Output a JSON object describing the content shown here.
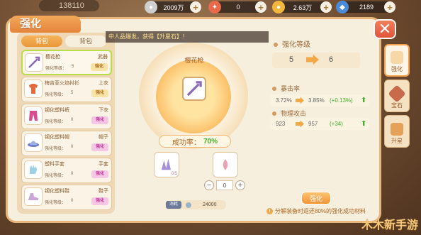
{
  "topbar": {
    "power": "138110",
    "currency": [
      {
        "value": "2009万",
        "color": "#cfcfcf",
        "icon": "silver-coin-icon"
      },
      {
        "value": "0",
        "color": "#e86a4a",
        "icon": "ticket-icon"
      },
      {
        "value": "2.63万",
        "color": "#f2b73b",
        "icon": "gold-coin-icon"
      },
      {
        "value": "2189",
        "color": "#4a8ad8",
        "icon": "diamond-icon"
      }
    ]
  },
  "header": {
    "title": "强化"
  },
  "left": {
    "tabs": [
      "背包",
      "背包"
    ],
    "items": [
      {
        "name": "樱花枪",
        "type": "武器",
        "level_label": "强化等级：",
        "level": "5",
        "action": "强化",
        "selected": true
      },
      {
        "name": "梅吉亚火焰衬衫",
        "type": "上衣",
        "level_label": "强化等级：",
        "level": "5",
        "action": "强化"
      },
      {
        "name": "钢化塑料裤",
        "type": "下衣",
        "level_label": "强化等级：",
        "level": "0",
        "action": "强化"
      },
      {
        "name": "钢化塑料帽",
        "type": "帽子",
        "level_label": "强化等级：",
        "level": "0",
        "action": "强化"
      },
      {
        "name": "塑料手套",
        "type": "手套",
        "level_label": "强化等级：",
        "level": "0",
        "action": "强化"
      },
      {
        "name": "钢化塑料鞋",
        "type": "鞋子",
        "level_label": "强化等级：",
        "level": "0",
        "action": "强化"
      }
    ]
  },
  "broadcast": "中人品爆发，获得【升星石】！",
  "center": {
    "weapon_name": "樱花枪",
    "success_label": "成功率：",
    "success_value": "70%",
    "material_count_1": "0/5",
    "material_count_2": "",
    "stepper_value": "0",
    "cost_label": "消耗",
    "cost_value": "24000"
  },
  "right": {
    "level_title": "强化等级",
    "level_from": "5",
    "level_to": "6",
    "crit_title": "暴击率",
    "crit_from": "3.72%",
    "crit_to": "3.85%",
    "crit_delta": "(+0.13%)",
    "atk_title": "物理攻击",
    "atk_from": "923",
    "atk_to": "957",
    "atk_delta": "(+34)",
    "strengthen_label": "强化",
    "tip": "分解装备时返还80%的强化成功材料"
  },
  "sidetabs": [
    "强化",
    "宝石",
    "升星"
  ],
  "watermark": "木木新手游"
}
